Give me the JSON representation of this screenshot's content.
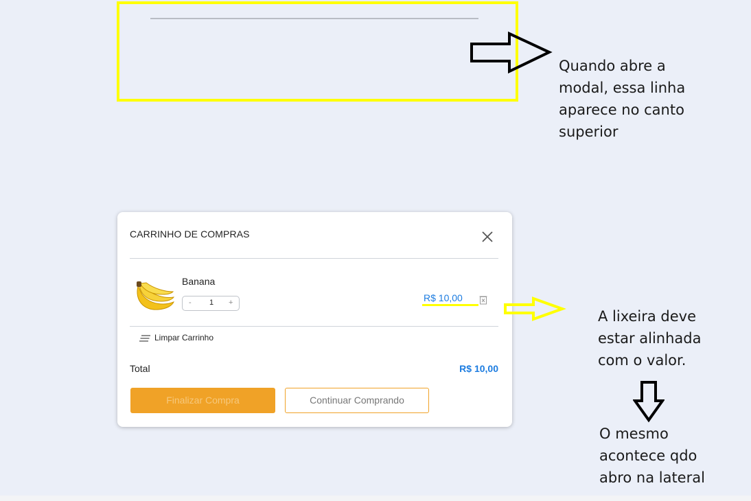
{
  "annotations": {
    "note_top": "Quando abre a\nmodal, essa linha\naparece no canto\nsuperior",
    "note_trash": "A lixeira deve\nestar alinhada\ncom o valor.",
    "note_side": "O mesmo\nacontece qdo\nabro na lateral",
    "highlight_color": "#ffff00"
  },
  "cart": {
    "title": "CARRINHO DE COMPRAS",
    "items": [
      {
        "name": "Banana",
        "quantity": "1",
        "minus": "-",
        "plus": "+",
        "price": "R$ 10,00",
        "icon": "banana-image"
      }
    ],
    "clear_label": "Limpar Carrinho",
    "total_label": "Total",
    "total_value": "R$ 10,00",
    "finish_label": "Finalizar Compra",
    "continue_label": "Continuar Comprando",
    "accent_color": "#f0a227",
    "price_color": "#1c7ce0"
  }
}
